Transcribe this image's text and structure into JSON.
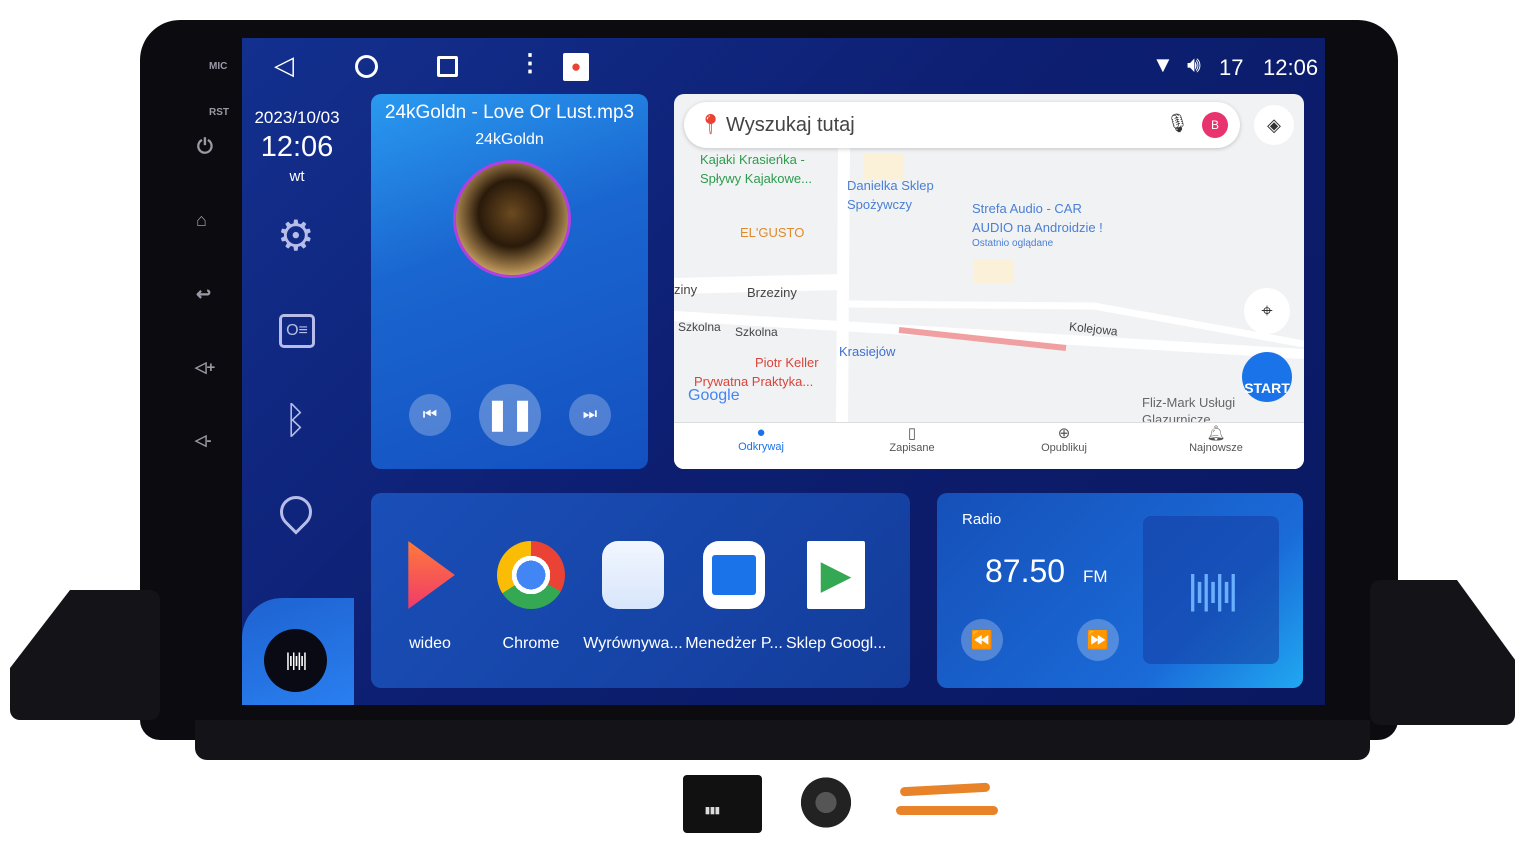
{
  "hardware": {
    "mic": "MIC",
    "rst": "RST"
  },
  "statusbar": {
    "signal": "17",
    "time": "12:06"
  },
  "sidebar": {
    "date": "2023/10/03",
    "time": "12:06",
    "day": "wt"
  },
  "music": {
    "title": "24kGoldn - Love Or Lust.mp3",
    "artist": "24kGoldn"
  },
  "map": {
    "search_placeholder": "Wyszukaj tutaj",
    "avatar_letter": "B",
    "places": [
      {
        "name": "Kajaki Krasieńka -",
        "name2": "Spływy Kajakowe...",
        "color": "#2e9b4e"
      },
      {
        "name": "Danielka Sklep",
        "name2": "Spożywczy",
        "color": "#4a7fd4"
      },
      {
        "name": "Strefa Audio - CAR",
        "name2": "AUDIO na Androidzie !",
        "sub": "Ostatnio oglądane",
        "color": "#4a7fd4"
      },
      {
        "name": "EL'GUSTO",
        "color": "#e08a2c"
      },
      {
        "name": "Piotr Keller",
        "name2": "Prywatna Praktyka...",
        "color": "#d9443a"
      },
      {
        "name": "Krasiejów",
        "color": "#3f6fd0"
      },
      {
        "name": "Fliz-Mark Usługi",
        "name2": "Glazurnicze",
        "color": "#666"
      }
    ],
    "streets": [
      "ziny",
      "Brzeziny",
      "Szkolna",
      "Szkolna",
      "Kolejowa"
    ],
    "google": "Google",
    "start": "START",
    "tabs": [
      "Odkrywaj",
      "Zapisane",
      "Opublikuj",
      "Najnowsze"
    ]
  },
  "apps": [
    {
      "label": "wideo"
    },
    {
      "label": "Chrome"
    },
    {
      "label": "Wyrównywa..."
    },
    {
      "label": "Menedżer P..."
    },
    {
      "label": "Sklep Googl..."
    }
  ],
  "radio": {
    "title": "Radio",
    "frequency": "87.50",
    "band": "FM"
  },
  "colors": {
    "screen_bg": "#0d1f72",
    "accent": "#1a73e8",
    "card": "#1547a8"
  }
}
